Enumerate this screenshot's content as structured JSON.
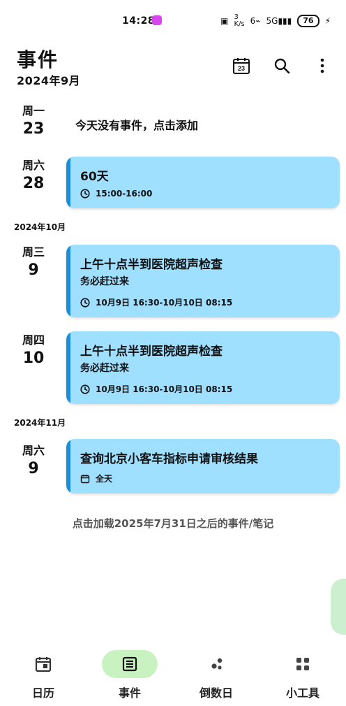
{
  "status": {
    "time": "14:28",
    "network": "3\nK/s",
    "wifi": "6",
    "signal": "5G",
    "battery": "76"
  },
  "header": {
    "title": "事件",
    "subtitle": "2024年9月",
    "calendar_button_day": "23"
  },
  "timeline": {
    "rows": [
      {
        "weekday": "周一",
        "day": "23",
        "empty_text": "今天没有事件，点击添加"
      },
      {
        "weekday": "周六",
        "day": "28",
        "card": {
          "title": "60天",
          "time": "15:00-16:00"
        }
      }
    ],
    "month_oct": "2024年10月",
    "oct_rows": [
      {
        "weekday": "周三",
        "day": "9",
        "card": {
          "title": "上午十点半到医院超声检查",
          "note": "务必赶过来",
          "time": "10月9日 16:30-10月10日 08:15"
        }
      },
      {
        "weekday": "周四",
        "day": "10",
        "card": {
          "title": "上午十点半到医院超声检查",
          "note": "务必赶过来",
          "time": "10月9日 16:30-10月10日 08:15"
        }
      }
    ],
    "month_nov": "2024年11月",
    "nov_rows": [
      {
        "weekday": "周六",
        "day": "9",
        "card": {
          "title": "查询北京小客车指标申请审核结果",
          "time": "全天"
        }
      }
    ],
    "load_more": "点击加载2025年7月31日之后的事件/笔记"
  },
  "bottom_nav": {
    "items": [
      {
        "label": "日历",
        "icon": "calendar-icon",
        "active": false
      },
      {
        "label": "事件",
        "icon": "list-icon",
        "active": true
      },
      {
        "label": "倒数日",
        "icon": "dots-icon",
        "active": false
      },
      {
        "label": "小工具",
        "icon": "grid-icon",
        "active": false
      }
    ]
  },
  "colors": {
    "card_bg": "#9fdfff",
    "card_accent": "#1b8ed8",
    "nav_active": "#c9f2c1"
  }
}
